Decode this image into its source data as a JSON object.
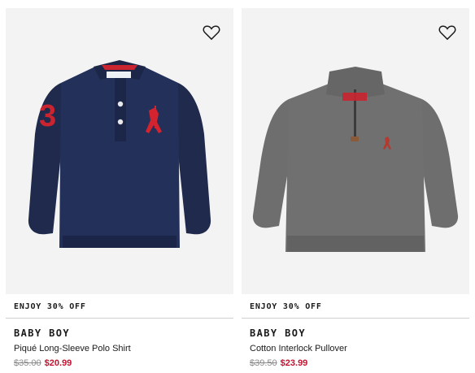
{
  "products": [
    {
      "image_alt": "Navy polo shirt",
      "promo": "ENJOY 30% OFF",
      "brand": "BABY BOY",
      "name": "Piqué Long-Sleeve Polo Shirt",
      "original_price": "$35.00",
      "sale_price": "$20.99",
      "favorite_icon": "heart-outline-icon"
    },
    {
      "image_alt": "Grey quarter-zip pullover",
      "promo": "ENJOY 30% OFF",
      "brand": "BABY BOY",
      "name": "Cotton Interlock Pullover",
      "original_price": "$39.50",
      "sale_price": "$23.99",
      "favorite_icon": "heart-outline-icon"
    }
  ],
  "colors": {
    "sale": "#c4122f",
    "navy": "#1f2a4d",
    "grey": "#6e6e6e",
    "card_bg": "#f3f3f3"
  }
}
